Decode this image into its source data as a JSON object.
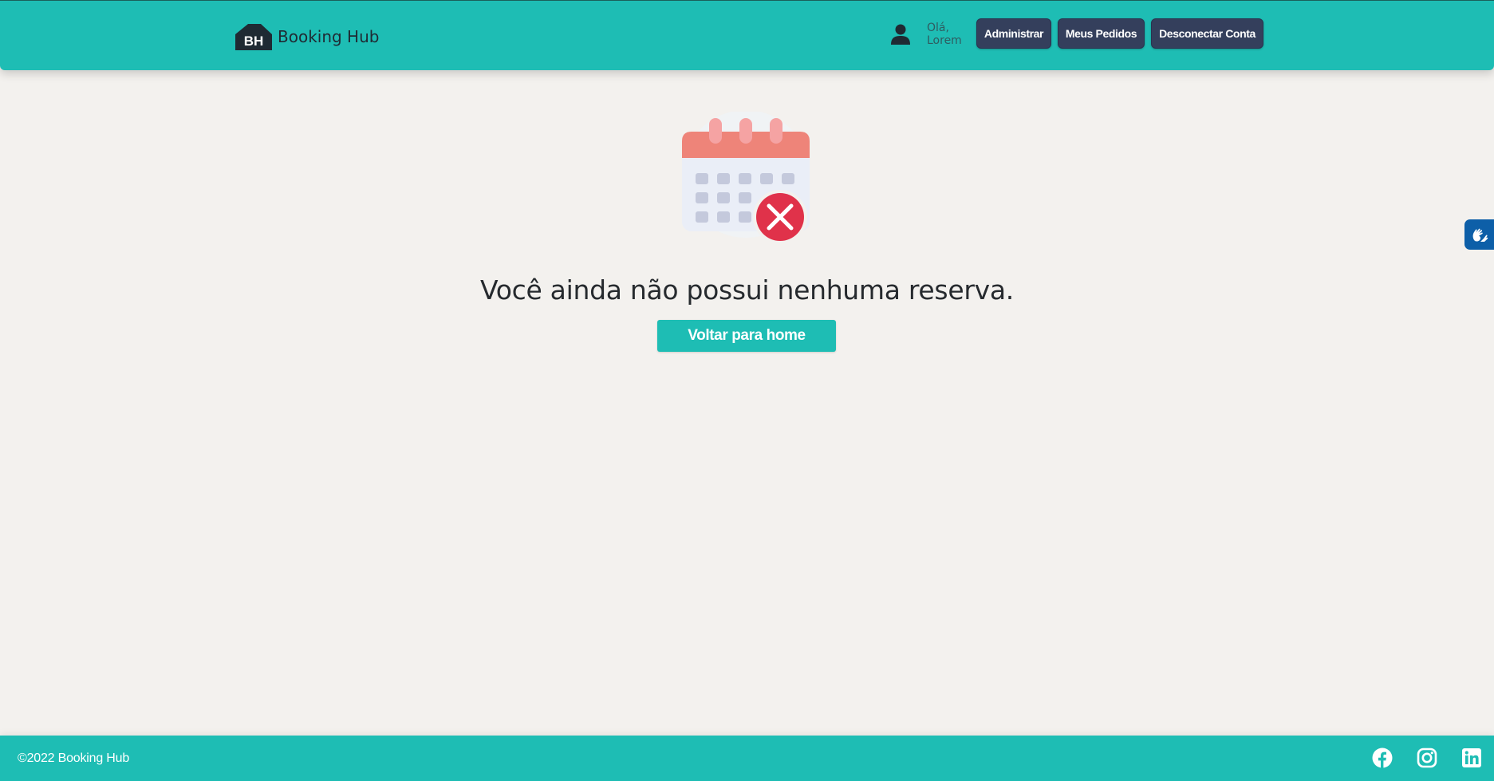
{
  "header": {
    "logo_mark": "BH",
    "brand_name": "Booking Hub",
    "greeting_line1": "Olá,",
    "greeting_line2": "Lorem",
    "buttons": {
      "admin": "Administrar",
      "orders": "Meus Pedidos",
      "logout": "Desconectar Conta"
    }
  },
  "main": {
    "illustration_icon": "calendar-cancel-icon",
    "empty_message": "Você ainda não possui nenhuma reserva.",
    "home_button": "Voltar para home"
  },
  "accessibility_widget": {
    "icon": "sign-language-hands-icon"
  },
  "footer": {
    "copyright": "©2022 Booking Hub",
    "social_icons": [
      "facebook-icon",
      "instagram-icon",
      "linkedin-icon"
    ]
  },
  "colors": {
    "primary": "#1ebdb4",
    "nav_button": "#343f5c",
    "background": "#f3f1ee",
    "error_red": "#e0324a",
    "calendar_header": "#ee8479",
    "accessibility_blue": "#0d5fa8"
  }
}
